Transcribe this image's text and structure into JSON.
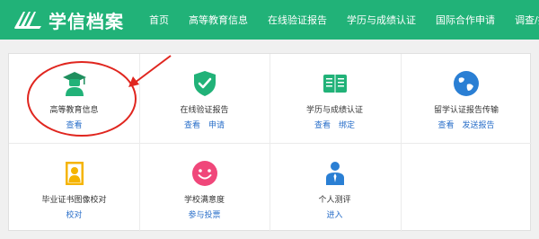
{
  "header": {
    "logo_text": "学信档案",
    "nav": [
      "首页",
      "高等教育信息",
      "在线验证报告",
      "学历与成绩认证",
      "国际合作申请",
      "调查/投票"
    ]
  },
  "cards": [
    {
      "title": "高等教育信息",
      "links": [
        "查看"
      ],
      "icon": "graduate-icon"
    },
    {
      "title": "在线验证报告",
      "links": [
        "查看",
        "申请"
      ],
      "icon": "shield-check-icon"
    },
    {
      "title": "学历与成绩认证",
      "links": [
        "查看",
        "绑定"
      ],
      "icon": "book-icon"
    },
    {
      "title": "留学认证报告传输",
      "links": [
        "查看",
        "发送报告"
      ],
      "icon": "globe-icon"
    },
    {
      "title": "毕业证书图像校对",
      "links": [
        "校对"
      ],
      "icon": "id-photo-icon"
    },
    {
      "title": "学校满意度",
      "links": [
        "参与投票"
      ],
      "icon": "smile-icon"
    },
    {
      "title": "个人测评",
      "links": [
        "进入"
      ],
      "icon": "person-icon"
    }
  ],
  "colors": {
    "header": "#21b278",
    "link": "#2a6fc9",
    "annotation": "#e0261f"
  }
}
